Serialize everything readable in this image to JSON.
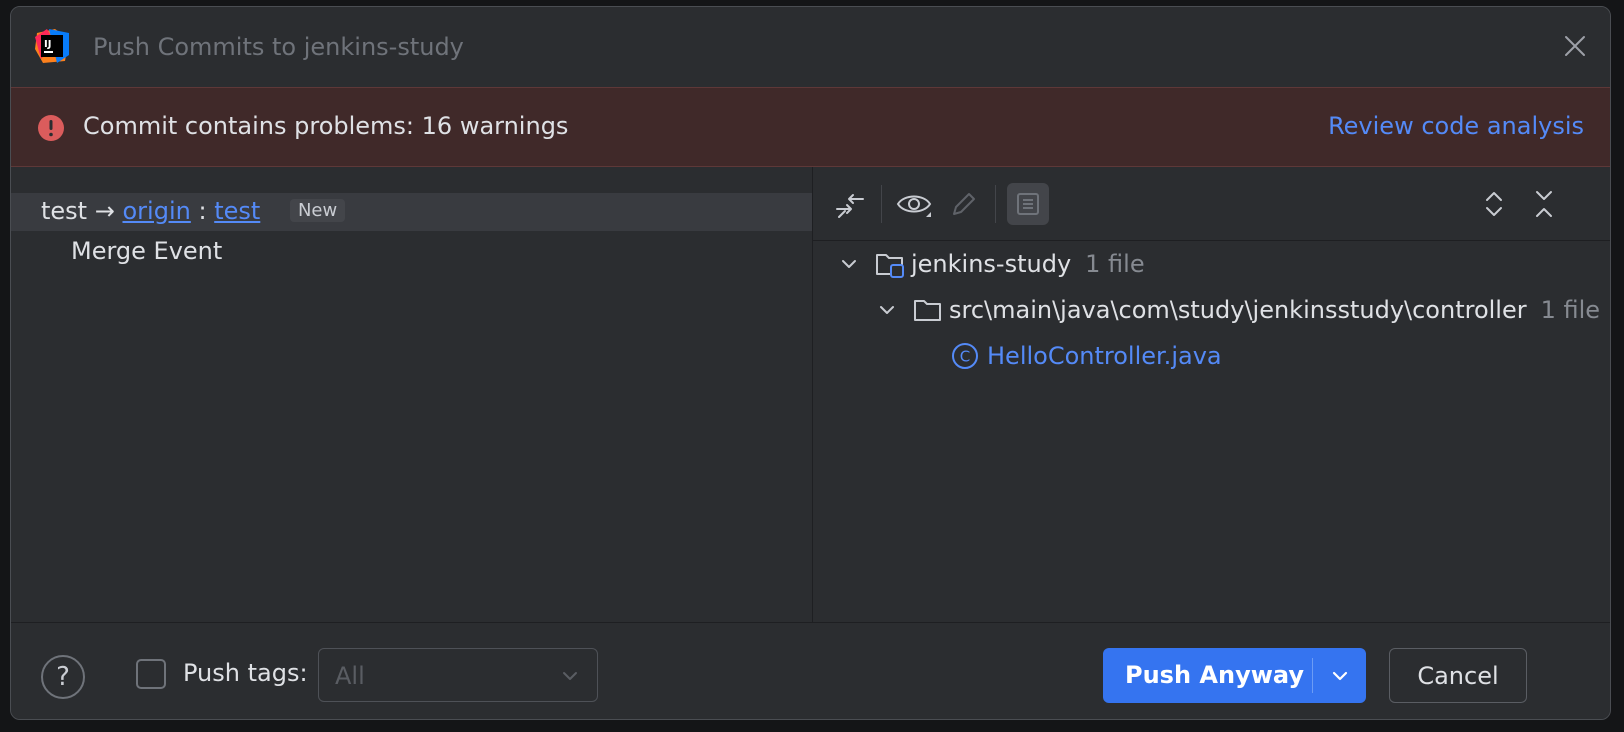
{
  "window": {
    "title": "Push Commits to jenkins-study",
    "app_icon": "intellij-logo-icon",
    "logo_text": "IJ"
  },
  "banner": {
    "message": "Commit contains problems: 16 warnings",
    "link": "Review code analysis",
    "icon": "error-icon"
  },
  "commits": {
    "branch_source": "test",
    "arrow": "→",
    "remote": "origin",
    "separator": ":",
    "branch_target": "test",
    "badge": "New",
    "items": [
      {
        "message": "Merge Event"
      }
    ]
  },
  "toolbar": {
    "icons": [
      "swap-arrows-icon",
      "eye-icon",
      "pencil-icon",
      "commit-details-icon",
      "expand-all-icon",
      "collapse-all-icon"
    ]
  },
  "tree": {
    "root": {
      "name": "jenkins-study",
      "meta": "1 file"
    },
    "folder": {
      "name": "src\\main\\java\\com\\study\\jenkinsstudy\\controller",
      "meta": "1 file"
    },
    "file": {
      "name": "HelloController.java",
      "icon_glyph": "C"
    }
  },
  "footer": {
    "help": "?",
    "push_tags_label": "Push tags:",
    "push_tags_checked": false,
    "tags_select_value": "All",
    "push_button": "Push Anyway",
    "cancel_button": "Cancel"
  },
  "colors": {
    "accent": "#3574f0",
    "link": "#548af7",
    "error": "#db5c5c",
    "banner_bg": "#402929"
  }
}
